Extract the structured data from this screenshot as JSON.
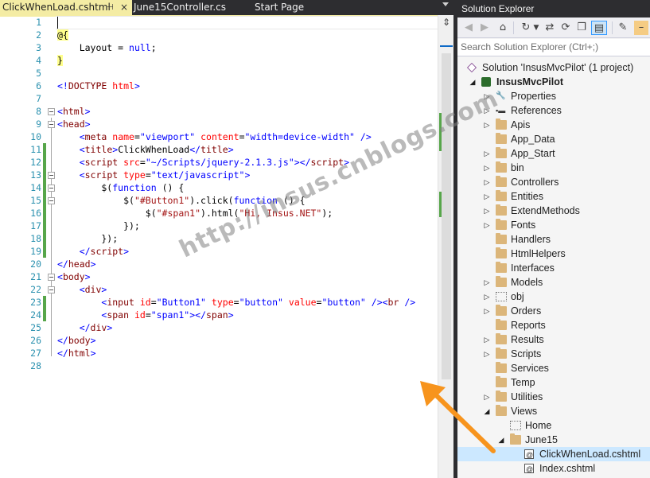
{
  "editor": {
    "tabs": [
      {
        "label": "ClickWhenLoad.cshtml",
        "active": true,
        "pin": "⊣",
        "close": "×"
      },
      {
        "label": "June15Controller.cs",
        "active": false
      },
      {
        "label": "Start Page",
        "active": false
      }
    ],
    "split_icon": "split-view-icon",
    "lines": [
      {
        "n": "1",
        "segs": []
      },
      {
        "n": "2",
        "segs": [
          {
            "t": "@{",
            "c": "razor"
          }
        ]
      },
      {
        "n": "3",
        "segs": [
          {
            "t": "    Layout = "
          },
          {
            "t": "null",
            "c": "kw"
          },
          {
            "t": ";"
          }
        ]
      },
      {
        "n": "4",
        "segs": [
          {
            "t": "}",
            "c": "razor"
          }
        ]
      },
      {
        "n": "5",
        "segs": []
      },
      {
        "n": "6",
        "segs": [
          {
            "t": "<!",
            "c": "ang"
          },
          {
            "t": "DOCTYPE",
            "c": "tag"
          },
          {
            "t": " "
          },
          {
            "t": "html",
            "c": "attr"
          },
          {
            "t": ">",
            "c": "ang"
          }
        ]
      },
      {
        "n": "7",
        "segs": []
      },
      {
        "n": "8",
        "segs": [
          {
            "t": "<",
            "c": "ang"
          },
          {
            "t": "html",
            "c": "tag"
          },
          {
            "t": ">",
            "c": "ang"
          }
        ]
      },
      {
        "n": "9",
        "segs": [
          {
            "t": "<",
            "c": "ang"
          },
          {
            "t": "head",
            "c": "tag"
          },
          {
            "t": ">",
            "c": "ang"
          }
        ]
      },
      {
        "n": "10",
        "segs": [
          {
            "t": "    <",
            "c": "ang"
          },
          {
            "t": "meta",
            "c": "tag"
          },
          {
            "t": " "
          },
          {
            "t": "name",
            "c": "attr"
          },
          {
            "t": "="
          },
          {
            "t": "\"viewport\"",
            "c": "aval"
          },
          {
            "t": " "
          },
          {
            "t": "content",
            "c": "attr"
          },
          {
            "t": "="
          },
          {
            "t": "\"width=device-width\"",
            "c": "aval"
          },
          {
            "t": " />",
            "c": "ang"
          }
        ]
      },
      {
        "n": "11",
        "segs": [
          {
            "t": "    <",
            "c": "ang"
          },
          {
            "t": "title",
            "c": "tag"
          },
          {
            "t": ">",
            "c": "ang"
          },
          {
            "t": "ClickWhenLoad"
          },
          {
            "t": "</",
            "c": "ang"
          },
          {
            "t": "title",
            "c": "tag"
          },
          {
            "t": ">",
            "c": "ang"
          }
        ]
      },
      {
        "n": "12",
        "segs": [
          {
            "t": "    <",
            "c": "ang"
          },
          {
            "t": "script",
            "c": "tag"
          },
          {
            "t": " "
          },
          {
            "t": "src",
            "c": "attr"
          },
          {
            "t": "="
          },
          {
            "t": "\"~/Scripts/jquery-2.1.3.js\"",
            "c": "aval"
          },
          {
            "t": "></",
            "c": "ang"
          },
          {
            "t": "script",
            "c": "tag"
          },
          {
            "t": ">",
            "c": "ang"
          }
        ]
      },
      {
        "n": "13",
        "segs": [
          {
            "t": "    <",
            "c": "ang"
          },
          {
            "t": "script",
            "c": "tag"
          },
          {
            "t": " "
          },
          {
            "t": "type",
            "c": "attr"
          },
          {
            "t": "="
          },
          {
            "t": "\"text/javascript\"",
            "c": "aval"
          },
          {
            "t": ">",
            "c": "ang"
          }
        ]
      },
      {
        "n": "14",
        "segs": [
          {
            "t": "        $("
          },
          {
            "t": "function",
            "c": "kw"
          },
          {
            "t": " () {"
          }
        ]
      },
      {
        "n": "15",
        "segs": [
          {
            "t": "            $("
          },
          {
            "t": "\"#Button1\"",
            "c": "str"
          },
          {
            "t": ").click("
          },
          {
            "t": "function",
            "c": "kw"
          },
          {
            "t": " () {"
          }
        ]
      },
      {
        "n": "16",
        "segs": [
          {
            "t": "                $("
          },
          {
            "t": "\"#span1\"",
            "c": "str"
          },
          {
            "t": ").html("
          },
          {
            "t": "\"Hi, Insus.NET\"",
            "c": "str"
          },
          {
            "t": ");"
          }
        ]
      },
      {
        "n": "17",
        "segs": [
          {
            "t": "            });"
          }
        ]
      },
      {
        "n": "18",
        "segs": [
          {
            "t": "        });"
          }
        ]
      },
      {
        "n": "19",
        "segs": [
          {
            "t": "    </",
            "c": "ang"
          },
          {
            "t": "script",
            "c": "tag"
          },
          {
            "t": ">",
            "c": "ang"
          }
        ]
      },
      {
        "n": "20",
        "segs": [
          {
            "t": "</",
            "c": "ang"
          },
          {
            "t": "head",
            "c": "tag"
          },
          {
            "t": ">",
            "c": "ang"
          }
        ]
      },
      {
        "n": "21",
        "segs": [
          {
            "t": "<",
            "c": "ang"
          },
          {
            "t": "body",
            "c": "tag"
          },
          {
            "t": ">",
            "c": "ang"
          }
        ]
      },
      {
        "n": "22",
        "segs": [
          {
            "t": "    <",
            "c": "ang"
          },
          {
            "t": "div",
            "c": "tag"
          },
          {
            "t": ">",
            "c": "ang"
          }
        ]
      },
      {
        "n": "23",
        "segs": [
          {
            "t": "        <",
            "c": "ang"
          },
          {
            "t": "input",
            "c": "tag"
          },
          {
            "t": " "
          },
          {
            "t": "id",
            "c": "attr"
          },
          {
            "t": "="
          },
          {
            "t": "\"Button1\"",
            "c": "aval"
          },
          {
            "t": " "
          },
          {
            "t": "type",
            "c": "attr"
          },
          {
            "t": "="
          },
          {
            "t": "\"button\"",
            "c": "aval"
          },
          {
            "t": " "
          },
          {
            "t": "value",
            "c": "attr"
          },
          {
            "t": "="
          },
          {
            "t": "\"button\"",
            "c": "aval"
          },
          {
            "t": " /><",
            "c": "ang"
          },
          {
            "t": "br",
            "c": "tag"
          },
          {
            "t": " />",
            "c": "ang"
          }
        ]
      },
      {
        "n": "24",
        "segs": [
          {
            "t": "        <",
            "c": "ang"
          },
          {
            "t": "span",
            "c": "tag"
          },
          {
            "t": " "
          },
          {
            "t": "id",
            "c": "attr"
          },
          {
            "t": "="
          },
          {
            "t": "\"span1\"",
            "c": "aval"
          },
          {
            "t": "></",
            "c": "ang"
          },
          {
            "t": "span",
            "c": "tag"
          },
          {
            "t": ">",
            "c": "ang"
          }
        ]
      },
      {
        "n": "25",
        "segs": [
          {
            "t": "    </",
            "c": "ang"
          },
          {
            "t": "div",
            "c": "tag"
          },
          {
            "t": ">",
            "c": "ang"
          }
        ]
      },
      {
        "n": "26",
        "segs": [
          {
            "t": "</",
            "c": "ang"
          },
          {
            "t": "body",
            "c": "tag"
          },
          {
            "t": ">",
            "c": "ang"
          }
        ]
      },
      {
        "n": "27",
        "segs": [
          {
            "t": "</",
            "c": "ang"
          },
          {
            "t": "html",
            "c": "tag"
          },
          {
            "t": ">",
            "c": "ang"
          }
        ]
      },
      {
        "n": "28",
        "segs": []
      }
    ]
  },
  "solution_explorer": {
    "title": "Solution Explorer",
    "search_placeholder": "Search Solution Explorer (Ctrl+;)",
    "toolbar_icons": [
      "back-icon",
      "forward-icon",
      "home-icon",
      "history-icon",
      "dropdown-icon",
      "sync-icon",
      "refresh-icon",
      "collapse-all-icon",
      "show-all-files-icon",
      "properties-icon",
      "pin-icon"
    ],
    "tree": [
      {
        "label": "Solution 'InsusMvcPilot' (1 project)",
        "depth": 0,
        "arrow": "",
        "icon": "solution-icon"
      },
      {
        "label": "InsusMvcPilot",
        "depth": 1,
        "arrow": "expanded",
        "icon": "web-project-icon",
        "bold": true
      },
      {
        "label": "Properties",
        "depth": 2,
        "arrow": "collapsed",
        "icon": "wrench-icon"
      },
      {
        "label": "References",
        "depth": 2,
        "arrow": "collapsed",
        "icon": "references-icon"
      },
      {
        "label": "Apis",
        "depth": 2,
        "arrow": "collapsed",
        "icon": "folder-icon"
      },
      {
        "label": "App_Data",
        "depth": 2,
        "arrow": "",
        "icon": "folder-icon"
      },
      {
        "label": "App_Start",
        "depth": 2,
        "arrow": "collapsed",
        "icon": "folder-icon"
      },
      {
        "label": "bin",
        "depth": 2,
        "arrow": "collapsed",
        "icon": "folder-icon"
      },
      {
        "label": "Controllers",
        "depth": 2,
        "arrow": "collapsed",
        "icon": "folder-icon"
      },
      {
        "label": "Entities",
        "depth": 2,
        "arrow": "collapsed",
        "icon": "folder-icon"
      },
      {
        "label": "ExtendMethods",
        "depth": 2,
        "arrow": "collapsed",
        "icon": "folder-icon"
      },
      {
        "label": "Fonts",
        "depth": 2,
        "arrow": "collapsed",
        "icon": "folder-icon"
      },
      {
        "label": "Handlers",
        "depth": 2,
        "arrow": "",
        "icon": "folder-icon"
      },
      {
        "label": "HtmlHelpers",
        "depth": 2,
        "arrow": "",
        "icon": "folder-icon"
      },
      {
        "label": "Interfaces",
        "depth": 2,
        "arrow": "",
        "icon": "folder-icon"
      },
      {
        "label": "Models",
        "depth": 2,
        "arrow": "collapsed",
        "icon": "folder-icon"
      },
      {
        "label": "obj",
        "depth": 2,
        "arrow": "collapsed",
        "icon": "hidden-folder-icon"
      },
      {
        "label": "Orders",
        "depth": 2,
        "arrow": "collapsed",
        "icon": "folder-icon"
      },
      {
        "label": "Reports",
        "depth": 2,
        "arrow": "",
        "icon": "folder-icon"
      },
      {
        "label": "Results",
        "depth": 2,
        "arrow": "collapsed",
        "icon": "folder-icon"
      },
      {
        "label": "Scripts",
        "depth": 2,
        "arrow": "collapsed",
        "icon": "folder-icon"
      },
      {
        "label": "Services",
        "depth": 2,
        "arrow": "",
        "icon": "folder-icon"
      },
      {
        "label": "Temp",
        "depth": 2,
        "arrow": "",
        "icon": "folder-icon"
      },
      {
        "label": "Utilities",
        "depth": 2,
        "arrow": "collapsed",
        "icon": "folder-icon"
      },
      {
        "label": "Views",
        "depth": 2,
        "arrow": "expanded",
        "icon": "open-folder-icon"
      },
      {
        "label": "Home",
        "depth": 3,
        "arrow": "",
        "icon": "hidden-folder-icon"
      },
      {
        "label": "June15",
        "depth": 3,
        "arrow": "expanded",
        "icon": "open-folder-icon"
      },
      {
        "label": "ClickWhenLoad.cshtml",
        "depth": 4,
        "arrow": "",
        "icon": "razor-file-icon",
        "selected": true
      },
      {
        "label": "Index.cshtml",
        "depth": 4,
        "arrow": "",
        "icon": "razor-file-icon"
      }
    ]
  },
  "watermark": "http://insus.cnblogs.com",
  "colors": {
    "tab_active": "#f4eca4",
    "dark_chrome": "#2d2d30",
    "change_bar": "#57a64a",
    "selected_row": "#cce8ff",
    "arrow": "#f7941d"
  }
}
